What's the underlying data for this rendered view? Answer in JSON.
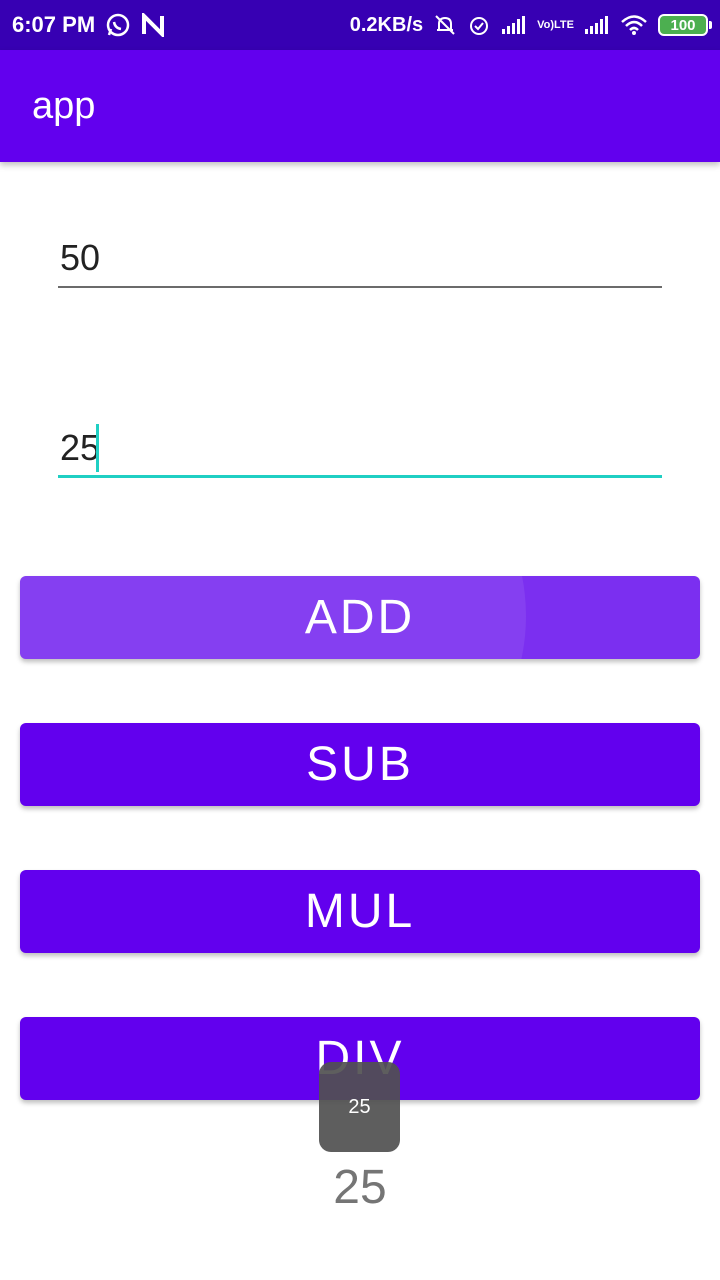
{
  "status_bar": {
    "time": "6:07 PM",
    "speed": "0.2KB/s",
    "network": "LTE",
    "volte": "Vo)",
    "battery": "100",
    "icons": [
      "whatsapp-icon",
      "n-notification-icon",
      "muted-bell-icon",
      "alarm-icon",
      "signal-icon",
      "volte-icon",
      "signal-icon",
      "wifi-icon",
      "battery-icon"
    ]
  },
  "app_bar": {
    "title": "app"
  },
  "inputs": {
    "first_value": "50",
    "second_value": "25"
  },
  "buttons": {
    "add": "ADD",
    "sub": "SUB",
    "mul": "MUL",
    "div": "DIV"
  },
  "result": "25",
  "toast": "25",
  "colors": {
    "status_bar": "#3700b3",
    "primary": "#6200ee",
    "pressed": "#7b2ff0",
    "accent": "#1fcfc3"
  }
}
